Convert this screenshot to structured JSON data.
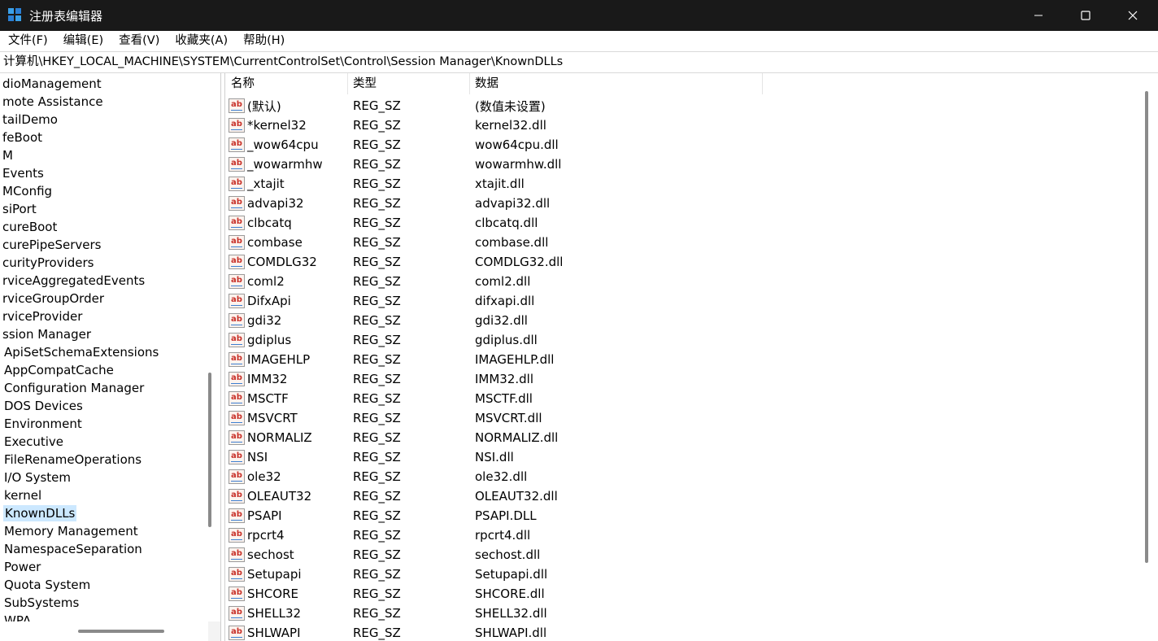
{
  "window": {
    "title": "注册表编辑器",
    "accent": "#3aa0e8"
  },
  "menu": [
    "文件(F)",
    "编辑(E)",
    "查看(V)",
    "收藏夹(A)",
    "帮助(H)"
  ],
  "address": "计算机\\HKEY_LOCAL_MACHINE\\SYSTEM\\CurrentControlSet\\Control\\Session Manager\\KnownDLLs",
  "tree": {
    "items": [
      {
        "label": "dioManagement",
        "child": false
      },
      {
        "label": "mote Assistance",
        "child": false
      },
      {
        "label": "tailDemo",
        "child": false
      },
      {
        "label": "feBoot",
        "child": false
      },
      {
        "label": "M",
        "child": false
      },
      {
        "label": "Events",
        "child": false
      },
      {
        "label": "MConfig",
        "child": false
      },
      {
        "label": "siPort",
        "child": false
      },
      {
        "label": "cureBoot",
        "child": false
      },
      {
        "label": "curePipeServers",
        "child": false
      },
      {
        "label": "curityProviders",
        "child": false
      },
      {
        "label": "rviceAggregatedEvents",
        "child": false
      },
      {
        "label": "rviceGroupOrder",
        "child": false
      },
      {
        "label": "rviceProvider",
        "child": false
      },
      {
        "label": "ssion Manager",
        "child": false
      },
      {
        "label": "ApiSetSchemaExtensions",
        "child": true
      },
      {
        "label": "AppCompatCache",
        "child": true
      },
      {
        "label": "Configuration Manager",
        "child": true
      },
      {
        "label": "DOS Devices",
        "child": true
      },
      {
        "label": "Environment",
        "child": true
      },
      {
        "label": "Executive",
        "child": true
      },
      {
        "label": "FileRenameOperations",
        "child": true
      },
      {
        "label": "I/O System",
        "child": true
      },
      {
        "label": "kernel",
        "child": true
      },
      {
        "label": "KnownDLLs",
        "child": true,
        "selected": true
      },
      {
        "label": "Memory Management",
        "child": true
      },
      {
        "label": "NamespaceSeparation",
        "child": true
      },
      {
        "label": "Power",
        "child": true
      },
      {
        "label": "Quota System",
        "child": true
      },
      {
        "label": "SubSystems",
        "child": true
      },
      {
        "label": "WPA",
        "child": true
      }
    ]
  },
  "list": {
    "columns": {
      "name": "名称",
      "type": "类型",
      "data": "数据"
    },
    "rows": [
      {
        "name": "(默认)",
        "type": "REG_SZ",
        "data": "(数值未设置)"
      },
      {
        "name": "*kernel32",
        "type": "REG_SZ",
        "data": "kernel32.dll"
      },
      {
        "name": "_wow64cpu",
        "type": "REG_SZ",
        "data": "wow64cpu.dll"
      },
      {
        "name": "_wowarmhw",
        "type": "REG_SZ",
        "data": "wowarmhw.dll"
      },
      {
        "name": "_xtajit",
        "type": "REG_SZ",
        "data": "xtajit.dll"
      },
      {
        "name": "advapi32",
        "type": "REG_SZ",
        "data": "advapi32.dll"
      },
      {
        "name": "clbcatq",
        "type": "REG_SZ",
        "data": "clbcatq.dll"
      },
      {
        "name": "combase",
        "type": "REG_SZ",
        "data": "combase.dll"
      },
      {
        "name": "COMDLG32",
        "type": "REG_SZ",
        "data": "COMDLG32.dll"
      },
      {
        "name": "coml2",
        "type": "REG_SZ",
        "data": "coml2.dll"
      },
      {
        "name": "DifxApi",
        "type": "REG_SZ",
        "data": "difxapi.dll"
      },
      {
        "name": "gdi32",
        "type": "REG_SZ",
        "data": "gdi32.dll"
      },
      {
        "name": "gdiplus",
        "type": "REG_SZ",
        "data": "gdiplus.dll"
      },
      {
        "name": "IMAGEHLP",
        "type": "REG_SZ",
        "data": "IMAGEHLP.dll"
      },
      {
        "name": "IMM32",
        "type": "REG_SZ",
        "data": "IMM32.dll"
      },
      {
        "name": "MSCTF",
        "type": "REG_SZ",
        "data": "MSCTF.dll"
      },
      {
        "name": "MSVCRT",
        "type": "REG_SZ",
        "data": "MSVCRT.dll"
      },
      {
        "name": "NORMALIZ",
        "type": "REG_SZ",
        "data": "NORMALIZ.dll"
      },
      {
        "name": "NSI",
        "type": "REG_SZ",
        "data": "NSI.dll"
      },
      {
        "name": "ole32",
        "type": "REG_SZ",
        "data": "ole32.dll"
      },
      {
        "name": "OLEAUT32",
        "type": "REG_SZ",
        "data": "OLEAUT32.dll"
      },
      {
        "name": "PSAPI",
        "type": "REG_SZ",
        "data": "PSAPI.DLL"
      },
      {
        "name": "rpcrt4",
        "type": "REG_SZ",
        "data": "rpcrt4.dll"
      },
      {
        "name": "sechost",
        "type": "REG_SZ",
        "data": "sechost.dll"
      },
      {
        "name": "Setupapi",
        "type": "REG_SZ",
        "data": "Setupapi.dll"
      },
      {
        "name": "SHCORE",
        "type": "REG_SZ",
        "data": "SHCORE.dll"
      },
      {
        "name": "SHELL32",
        "type": "REG_SZ",
        "data": "SHELL32.dll"
      },
      {
        "name": "SHLWAPI",
        "type": "REG_SZ",
        "data": "SHLWAPI.dll"
      }
    ],
    "value_icon": "string-value-icon"
  }
}
